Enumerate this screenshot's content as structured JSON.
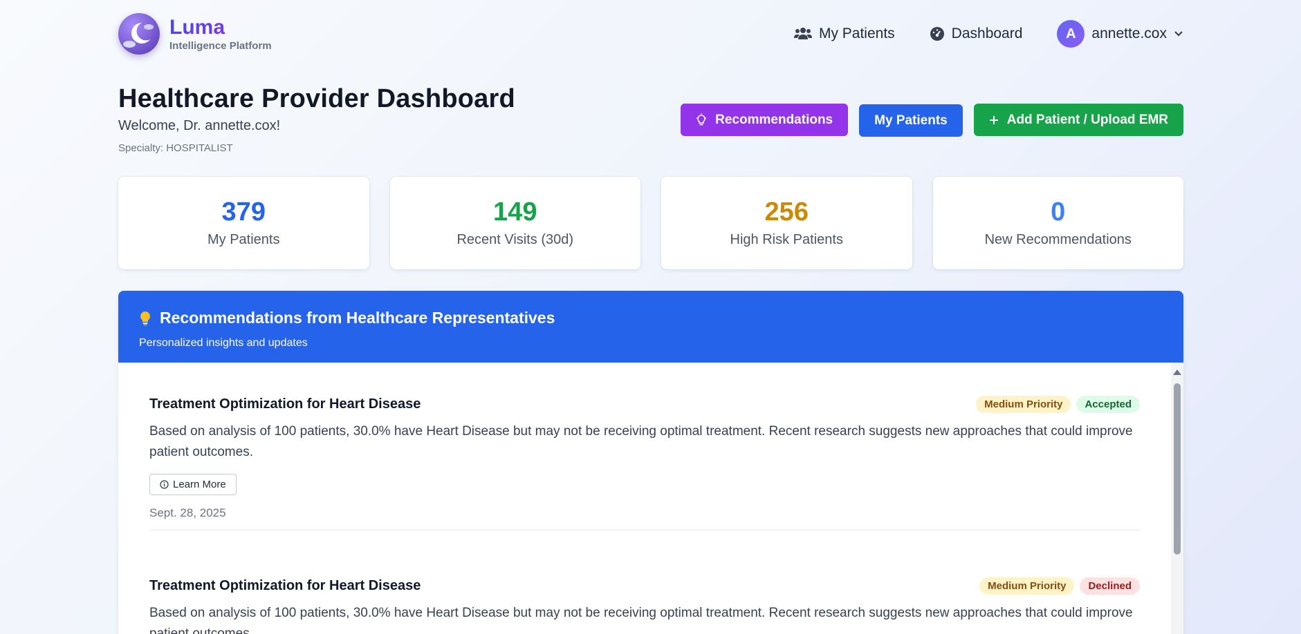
{
  "brand": {
    "name": "Luma",
    "subtitle": "Intelligence Platform"
  },
  "nav": {
    "my_patients": "My Patients",
    "dashboard": "Dashboard",
    "user_initial": "A",
    "username": "annette.cox"
  },
  "header": {
    "title": "Healthcare Provider Dashboard",
    "welcome": "Welcome, Dr. annette.cox!",
    "specialty": "Specialty: HOSPITALIST"
  },
  "actions": {
    "recommendations": "Recommendations",
    "my_patients": "My Patients",
    "add_patient": "Add Patient / Upload EMR"
  },
  "stats": [
    {
      "value": "379",
      "label": "My Patients",
      "color": "#2563eb"
    },
    {
      "value": "149",
      "label": "Recent Visits (30d)",
      "color": "#16a34a"
    },
    {
      "value": "256",
      "label": "High Risk Patients",
      "color": "#ca8a04"
    },
    {
      "value": "0",
      "label": "New Recommendations",
      "color": "#3b82f6"
    }
  ],
  "recommendations_panel": {
    "title": "Recommendations from Healthcare Representatives",
    "subtitle": "Personalized insights and updates",
    "items": [
      {
        "title": "Treatment Optimization for Heart Disease",
        "priority": "Medium Priority",
        "status": "Accepted",
        "description": "Based on analysis of 100 patients, 30.0% have Heart Disease but may not be receiving optimal treatment. Recent research suggests new approaches that could improve patient outcomes.",
        "learn_more": "Learn More",
        "date": "Sept. 28, 2025"
      },
      {
        "title": "Treatment Optimization for Heart Disease",
        "priority": "Medium Priority",
        "status": "Declined",
        "description": "Based on analysis of 100 patients, 30.0% have Heart Disease but may not be receiving optimal treatment. Recent research suggests new approaches that could improve patient outcomes."
      }
    ]
  },
  "colors": {
    "primary": "#2563eb",
    "purple": "#9333ea",
    "green": "#16a34a"
  }
}
